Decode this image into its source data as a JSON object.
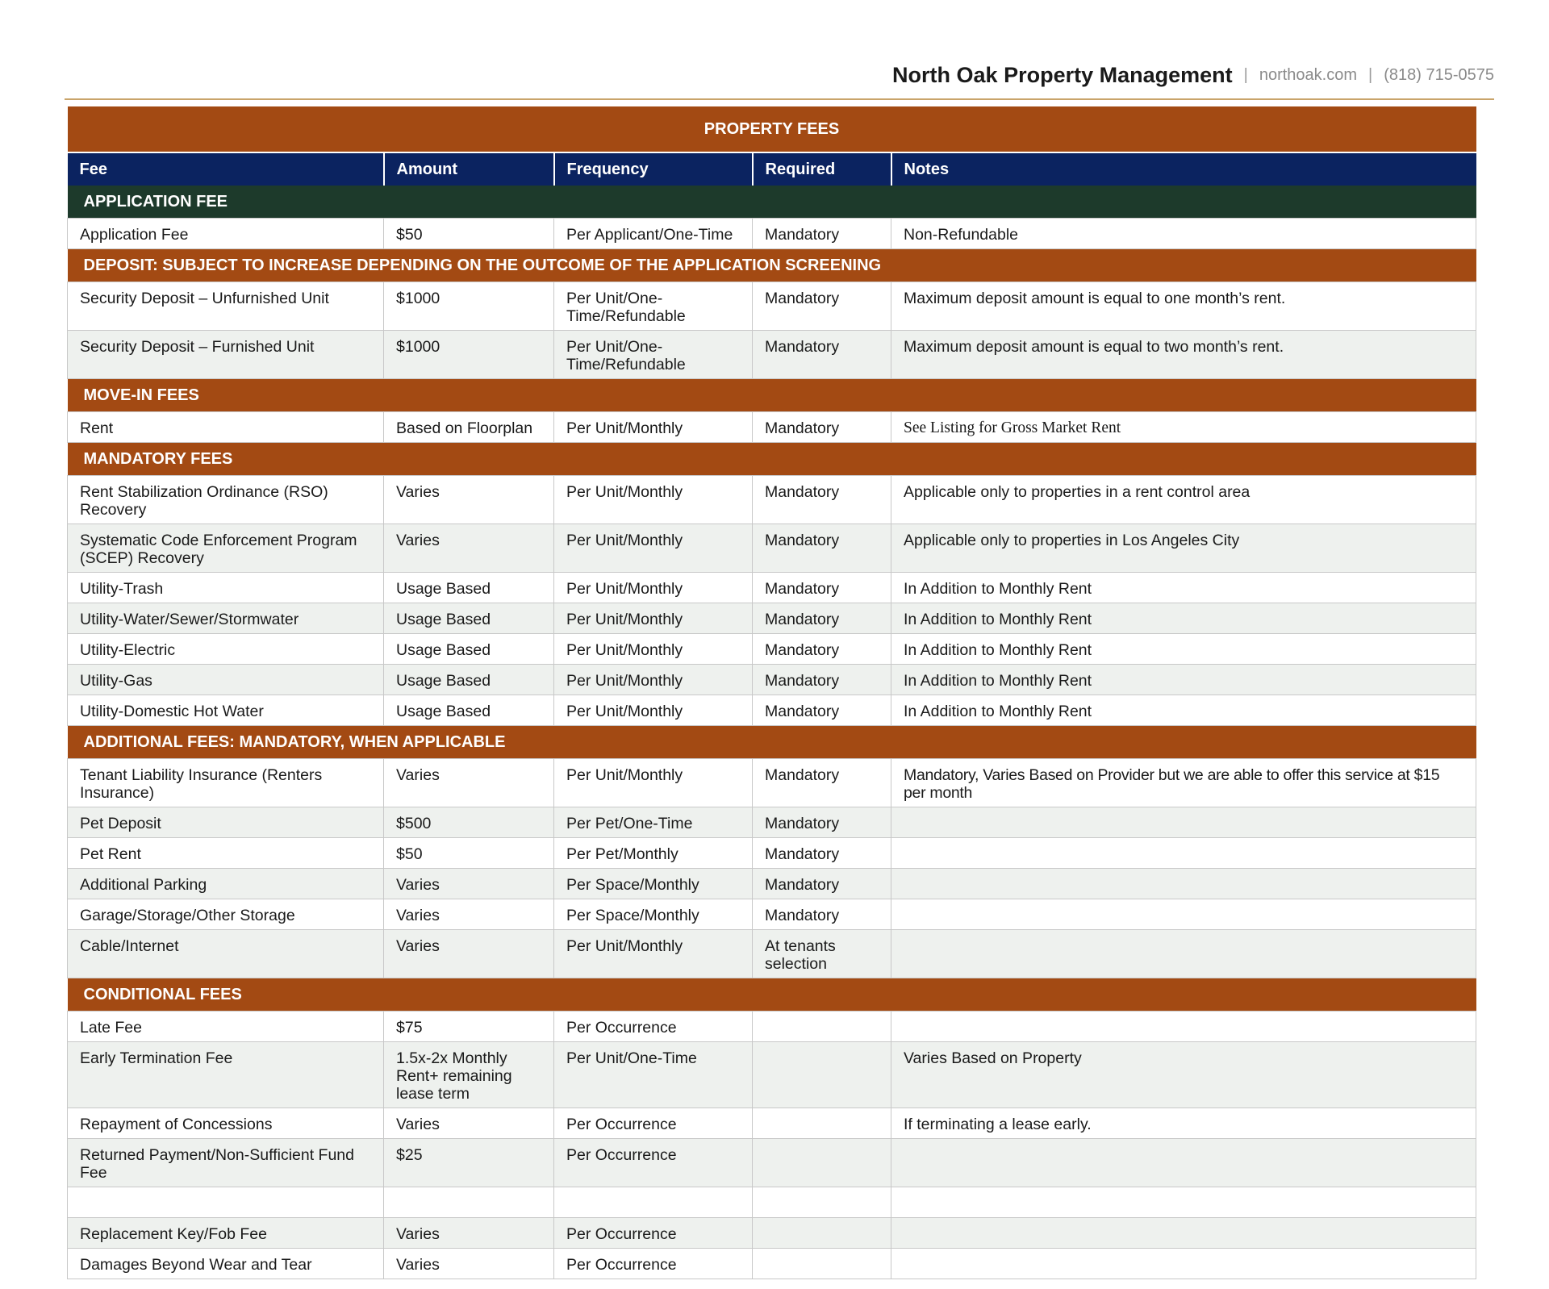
{
  "header": {
    "company": "North Oak Property Management",
    "separator": "|",
    "website": "northoak.com",
    "phone": "(818) 715-0575"
  },
  "table": {
    "title": "PROPERTY FEES",
    "columns": [
      "Fee",
      "Amount",
      "Frequency",
      "Required",
      "Notes"
    ],
    "sections": [
      {
        "label": "APPLICATION FEE",
        "style": "dark",
        "rows": [
          [
            "Application Fee",
            "$50",
            "Per Applicant/One-Time",
            "Mandatory",
            "Non-Refundable"
          ]
        ]
      },
      {
        "label": "DEPOSIT: SUBJECT TO INCREASE DEPENDING ON THE OUTCOME OF THE APPLICATION SCREENING",
        "style": "rust",
        "rows": [
          [
            "Security Deposit – Unfurnished Unit",
            "$1000",
            "Per Unit/One-Time/Refundable",
            "Mandatory",
            "Maximum deposit amount is equal to one month’s rent."
          ],
          [
            "Security Deposit – Furnished Unit",
            "$1000",
            "Per Unit/One-Time/Refundable",
            "Mandatory",
            "Maximum deposit amount is equal to two month’s rent."
          ]
        ]
      },
      {
        "label": "MOVE-IN FEES",
        "style": "rust",
        "rows": [
          [
            "Rent",
            "Based on Floorplan",
            "Per Unit/Monthly",
            "Mandatory",
            "See Listing for Gross Market Rent"
          ]
        ]
      },
      {
        "label": "MANDATORY FEES",
        "style": "rust",
        "rows": [
          [
            "Rent Stabilization Ordinance (RSO) Recovery",
            "Varies",
            "Per Unit/Monthly",
            "Mandatory",
            "Applicable only to properties in a rent control area"
          ],
          [
            "Systematic Code Enforcement Program (SCEP) Recovery",
            "Varies",
            "Per Unit/Monthly",
            "Mandatory",
            "Applicable only to properties in Los Angeles City"
          ],
          [
            "Utility-Trash",
            "Usage Based",
            "Per Unit/Monthly",
            "Mandatory",
            "In Addition to Monthly Rent"
          ],
          [
            "Utility-Water/Sewer/Stormwater",
            "Usage Based",
            "Per Unit/Monthly",
            "Mandatory",
            "In Addition to Monthly Rent"
          ],
          [
            "Utility-Electric",
            "Usage Based",
            "Per Unit/Monthly",
            "Mandatory",
            "In Addition to Monthly Rent"
          ],
          [
            "Utility-Gas",
            "Usage Based",
            "Per Unit/Monthly",
            "Mandatory",
            "In Addition to Monthly Rent"
          ],
          [
            "Utility-Domestic Hot Water",
            "Usage Based",
            "Per Unit/Monthly",
            "Mandatory",
            "In Addition to Monthly Rent"
          ]
        ]
      },
      {
        "label": "ADDITIONAL FEES: MANDATORY, WHEN APPLICABLE",
        "style": "rust",
        "rows": [
          [
            "Tenant Liability Insurance (Renters Insurance)",
            "Varies",
            "Per Unit/Monthly",
            "Mandatory",
            "Mandatory, Varies Based on Provider but we are able to offer this service at $15 per month"
          ],
          [
            "Pet Deposit",
            "$500",
            "Per Pet/One-Time",
            "Mandatory",
            ""
          ],
          [
            "Pet Rent",
            "$50",
            "Per Pet/Monthly",
            "Mandatory",
            ""
          ],
          [
            "Additional Parking",
            "Varies",
            "Per Space/Monthly",
            "Mandatory",
            ""
          ],
          [
            "Garage/Storage/Other Storage",
            "Varies",
            "Per Space/Monthly",
            "Mandatory",
            ""
          ],
          [
            "Cable/Internet",
            "Varies",
            "Per Unit/Monthly",
            "At tenants selection",
            ""
          ]
        ]
      },
      {
        "label": "CONDITIONAL FEES",
        "style": "rust",
        "rows": [
          [
            "Late Fee",
            "$75",
            "Per Occurrence",
            "",
            ""
          ],
          [
            "Early Termination Fee",
            "1.5x-2x Monthly Rent+ remaining lease term",
            "Per Unit/One-Time",
            "",
            "Varies Based on Property"
          ],
          [
            "Repayment of Concessions",
            "Varies",
            "Per Occurrence",
            "",
            "If terminating a lease early."
          ],
          [
            "Returned Payment/Non-Sufficient Fund Fee",
            "$25",
            "Per Occurrence",
            "",
            ""
          ],
          [
            "",
            "",
            "",
            "",
            ""
          ],
          [
            "Replacement Key/Fob Fee",
            "Varies",
            "Per Occurrence",
            "",
            ""
          ],
          [
            "Damages Beyond Wear and Tear",
            "Varies",
            "Per Occurrence",
            "",
            ""
          ]
        ]
      }
    ]
  }
}
